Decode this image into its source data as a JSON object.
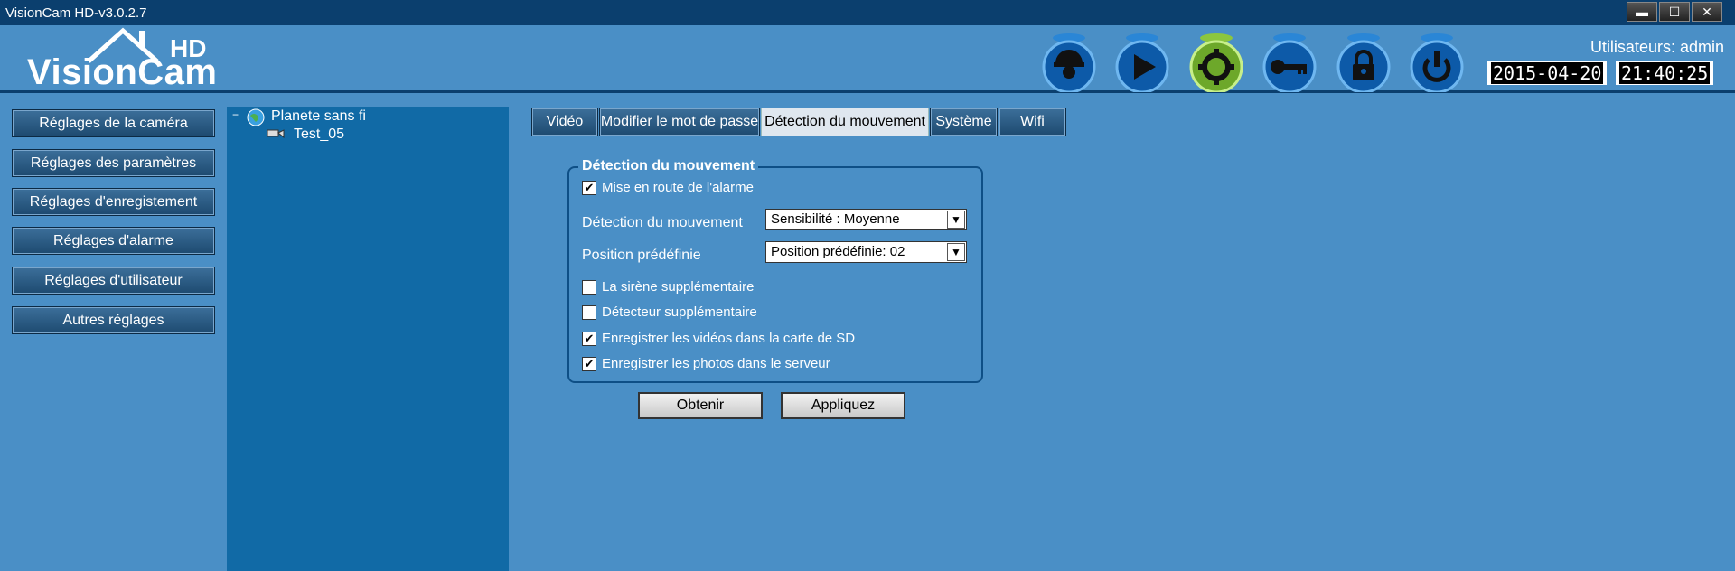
{
  "window": {
    "title": "VisionCam HD-v3.0.2.7",
    "controls": [
      "minimize-icon",
      "maximize-icon",
      "close-icon"
    ]
  },
  "header": {
    "logo_text": "VisionCam",
    "logo_hd": "HD",
    "nav_icons": [
      "camera-icon",
      "play-icon",
      "gear-icon",
      "key-icon",
      "lock-icon",
      "power-icon"
    ],
    "active_nav": "gear-icon",
    "users_label": "Utilisateurs: admin",
    "date": "2015-04-20",
    "time": "21:40:25"
  },
  "sidebar": {
    "items": [
      {
        "label": "Réglages de la caméra"
      },
      {
        "label": "Réglages des paramètres"
      },
      {
        "label": "Réglages d'enregistement"
      },
      {
        "label": "Réglages d'alarme"
      },
      {
        "label": "Réglages d'utilisateur"
      },
      {
        "label": "Autres réglages"
      }
    ]
  },
  "tree": {
    "root_label": "Planete sans fi",
    "child_label": "Test_05"
  },
  "tabs": [
    {
      "label": "Vidéo"
    },
    {
      "label": "Modifier le mot de passe"
    },
    {
      "label": "Détection du mouvement",
      "active": true
    },
    {
      "label": "Système"
    },
    {
      "label": "Wifi"
    }
  ],
  "motion": {
    "group_title": "Détection du mouvement",
    "alarm_on": {
      "label": "Mise en route de l'alarme",
      "checked": true
    },
    "detection_label": "Détection du mouvement",
    "detection_value": "Sensibilité : Moyenne",
    "preset_label": "Position prédéfinie",
    "preset_value": "Position prédéfinie: 02",
    "siren": {
      "label": "La sirène supplémentaire",
      "checked": false
    },
    "detector": {
      "label": "Détecteur supplémentaire",
      "checked": false
    },
    "record_sd": {
      "label": "Enregistrer les vidéos dans la carte de SD",
      "checked": true
    },
    "record_server": {
      "label": "Enregistrer les photos dans le serveur",
      "checked": true
    }
  },
  "actions": {
    "get_label": "Obtenir",
    "apply_label": "Appliquez"
  },
  "colors": {
    "background": "#4a8fc6",
    "titlebar": "#0b3f6e",
    "tree_panel": "#116aa6",
    "active_icon": "#8cc63f"
  }
}
